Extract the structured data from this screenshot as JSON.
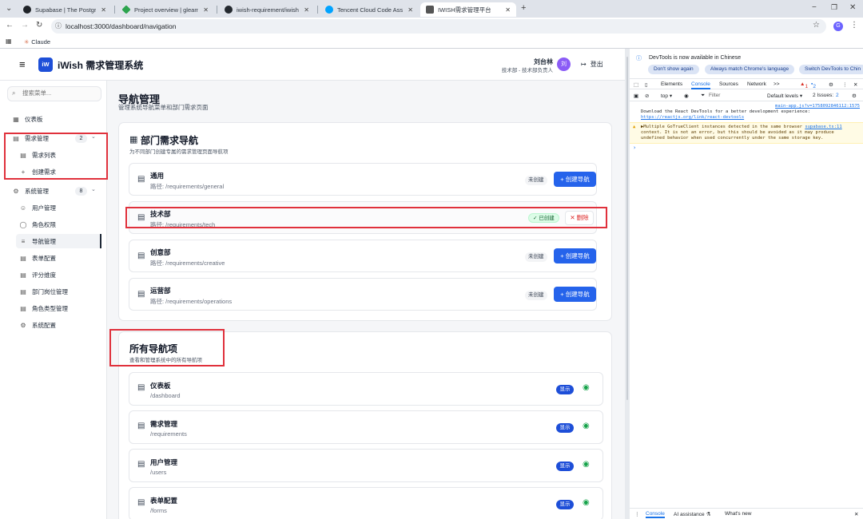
{
  "browser": {
    "tabs": [
      {
        "title": "Supabase | The Postgres Dev",
        "color": "#1f2328"
      },
      {
        "title": "Project overview | gleaming",
        "color": "#2da44e"
      },
      {
        "title": "iwish-requirement/iwish-req",
        "color": "#24292f"
      },
      {
        "title": "Tencent Cloud Code Assistan",
        "color": "#00a3ff"
      },
      {
        "title": "IWISH需求管理平台",
        "color": "#555555"
      }
    ],
    "url": "localhost:3000/dashboard/navigation",
    "bookmark": "Claude",
    "profile_initial": "G"
  },
  "app": {
    "logo": "iW",
    "title": "iWish 需求管理系统",
    "user_name": "刘台林",
    "user_role": "技术部 - 技术部负责人",
    "avatar": "刘",
    "logout": "登出"
  },
  "sidebar": {
    "search_placeholder": "搜索菜单...",
    "items": [
      {
        "label": "仪表板",
        "icon": "grid-icon",
        "glyph": "▦"
      },
      {
        "label": "需求管理",
        "icon": "file-icon",
        "glyph": "▤",
        "badge": "2",
        "chevron": "⌄"
      },
      {
        "label": "需求列表",
        "icon": "file-icon",
        "glyph": "▤"
      },
      {
        "label": "创建需求",
        "icon": "plus-icon",
        "glyph": "+"
      },
      {
        "label": "系统管理",
        "icon": "gear-icon",
        "glyph": "⚙",
        "badge": "8",
        "chevron": "⌄"
      },
      {
        "label": "用户管理",
        "icon": "users-icon",
        "glyph": "☺"
      },
      {
        "label": "角色权限",
        "icon": "shield-icon",
        "glyph": "◯"
      },
      {
        "label": "导航管理",
        "icon": "menu-icon",
        "glyph": "≡"
      },
      {
        "label": "表单配置",
        "icon": "file-icon",
        "glyph": "▤"
      },
      {
        "label": "评分维度",
        "icon": "file-icon",
        "glyph": "▤"
      },
      {
        "label": "部门岗位管理",
        "icon": "file-icon",
        "glyph": "▤"
      },
      {
        "label": "角色类型管理",
        "icon": "file-icon",
        "glyph": "▤"
      },
      {
        "label": "系统配置",
        "icon": "gear-icon",
        "glyph": "⚙"
      }
    ]
  },
  "main": {
    "title": "导航管理",
    "subtitle": "管理系统导航菜单和部门需求页面",
    "dept": {
      "title": "部门需求导航",
      "subtitle": "为不同部门创建专属的需求管理页面导航项",
      "rows": [
        {
          "name": "通用",
          "path": "路径: /requirements/general",
          "status": "未创建",
          "action": "+ 创建导航"
        },
        {
          "name": "技术部",
          "path": "路径: /requirements/tech",
          "status": "✓ 已创建",
          "action": "✕ 删除"
        },
        {
          "name": "创意部",
          "path": "路径: /requirements/creative",
          "status": "未创建",
          "action": "+ 创建导航"
        },
        {
          "name": "运营部",
          "path": "路径: /requirements/operations",
          "status": "未创建",
          "action": "+ 创建导航"
        }
      ]
    },
    "all": {
      "title": "所有导航项",
      "subtitle": "查看和管理系统中的所有导航项",
      "rows": [
        {
          "name": "仪表板",
          "path": "/dashboard",
          "badge": "显示"
        },
        {
          "name": "需求管理",
          "path": "/requirements",
          "badge": "显示"
        },
        {
          "name": "用户管理",
          "path": "/users",
          "badge": "显示"
        },
        {
          "name": "表单配置",
          "path": "/forms",
          "badge": "显示"
        }
      ]
    }
  },
  "devtools": {
    "info": "DevTools is now available in Chinese",
    "pills": [
      "Don't show again",
      "Always match Chrome's language",
      "Switch DevTools to Chin"
    ],
    "tabs": [
      "Elements",
      "Console",
      "Sources",
      "Network",
      ">>"
    ],
    "counts": {
      "errors": "1",
      "messages": "2"
    },
    "toolbar": {
      "context": "top ▾",
      "filter": "Filter",
      "levels": "Default levels ▾",
      "issues": "2 Issues:",
      "issues_count": "2"
    },
    "logs": [
      {
        "src": "main-app.js?v=1758092846112:1575",
        "text": "Download the React DevTools for a better development experience: ",
        "link": "https://reactjs.org/link/react-devtools"
      },
      {
        "text": "▶Multiple GoTrueClient instances detected in the same browser ",
        "link": "supabase.ts:11",
        "text2": " context. It is not an error, but this should be avoided as it may produce undefined behavior when used concurrently under the same storage key."
      }
    ],
    "bottom_tabs": [
      "Console",
      "AI assistance ⚗",
      "What's new"
    ]
  }
}
